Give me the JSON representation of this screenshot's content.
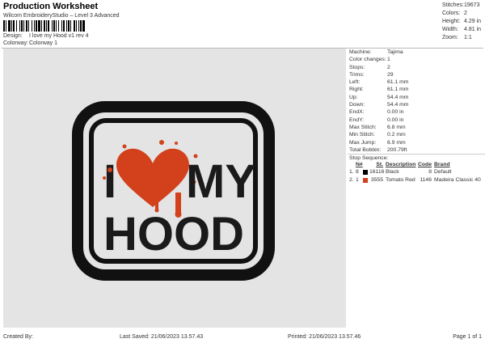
{
  "header": {
    "title": "Production Worksheet",
    "subtitle": "Wilcom EmbroideryStudio – Level 3 Advanced",
    "design_label": "Design:",
    "design_value": "I love my Hood v1 rev 4",
    "colorway_label": "Colorway:",
    "colorway_value": "Colorway 1"
  },
  "stats": [
    {
      "label": "Stitches:",
      "value": "19673"
    },
    {
      "label": "Colors:",
      "value": "2"
    },
    {
      "label": "Height:",
      "value": "4.29 in"
    },
    {
      "label": "Width:",
      "value": "4.81 in"
    },
    {
      "label": "Zoom:",
      "value": "1:1"
    }
  ],
  "design_text": {
    "letter_i": "I",
    "word_my": "MY",
    "word_hood": "HOOD"
  },
  "properties": [
    {
      "label": "Machine:",
      "value": "Tajima"
    },
    {
      "label": "Color changes:",
      "value": "1"
    },
    {
      "label": "Stops:",
      "value": "2"
    },
    {
      "label": "Trims:",
      "value": "29"
    },
    {
      "label": "Left:",
      "value": "61.1 mm"
    },
    {
      "label": "Right:",
      "value": "61.1 mm"
    },
    {
      "label": "Up:",
      "value": "54.4 mm"
    },
    {
      "label": "Down:",
      "value": "54.4 mm"
    },
    {
      "label": "EndX:",
      "value": "0.00 in"
    },
    {
      "label": "EndY:",
      "value": "0.00 in"
    },
    {
      "label": "Max Stitch:",
      "value": "6.8 mm"
    },
    {
      "label": "Min Stitch:",
      "value": "0.2 mm"
    },
    {
      "label": "Max Jump:",
      "value": "6.9 mm"
    },
    {
      "label": "Total Bobbin:",
      "value": "200.79ft"
    }
  ],
  "sequence": {
    "title": "Stop Sequence:",
    "headers": {
      "n": "N#",
      "st": "St.",
      "desc": "Description",
      "code": "Code",
      "brand": "Brand"
    },
    "rows": [
      {
        "idx": "1.",
        "n": "8",
        "color": "#000000",
        "st": "16116",
        "desc": "Black",
        "code": "8",
        "brand": "Default"
      },
      {
        "idx": "2.",
        "n": "1",
        "color": "#d2411c",
        "st": "3555",
        "desc": "Tomato Red",
        "code": "1146",
        "brand": "Madeira Classic 40"
      }
    ]
  },
  "footer": {
    "created_by": "Created By:",
    "last_saved": "Last Saved: 21/06/2023 13.57.43",
    "printed": "Printed: 21/06/2023 13.57.46",
    "page": "Page 1 of 1"
  },
  "colors": {
    "canvas_bg": "#e4e4e4",
    "outline": "#111111",
    "heart": "#d2411c"
  }
}
